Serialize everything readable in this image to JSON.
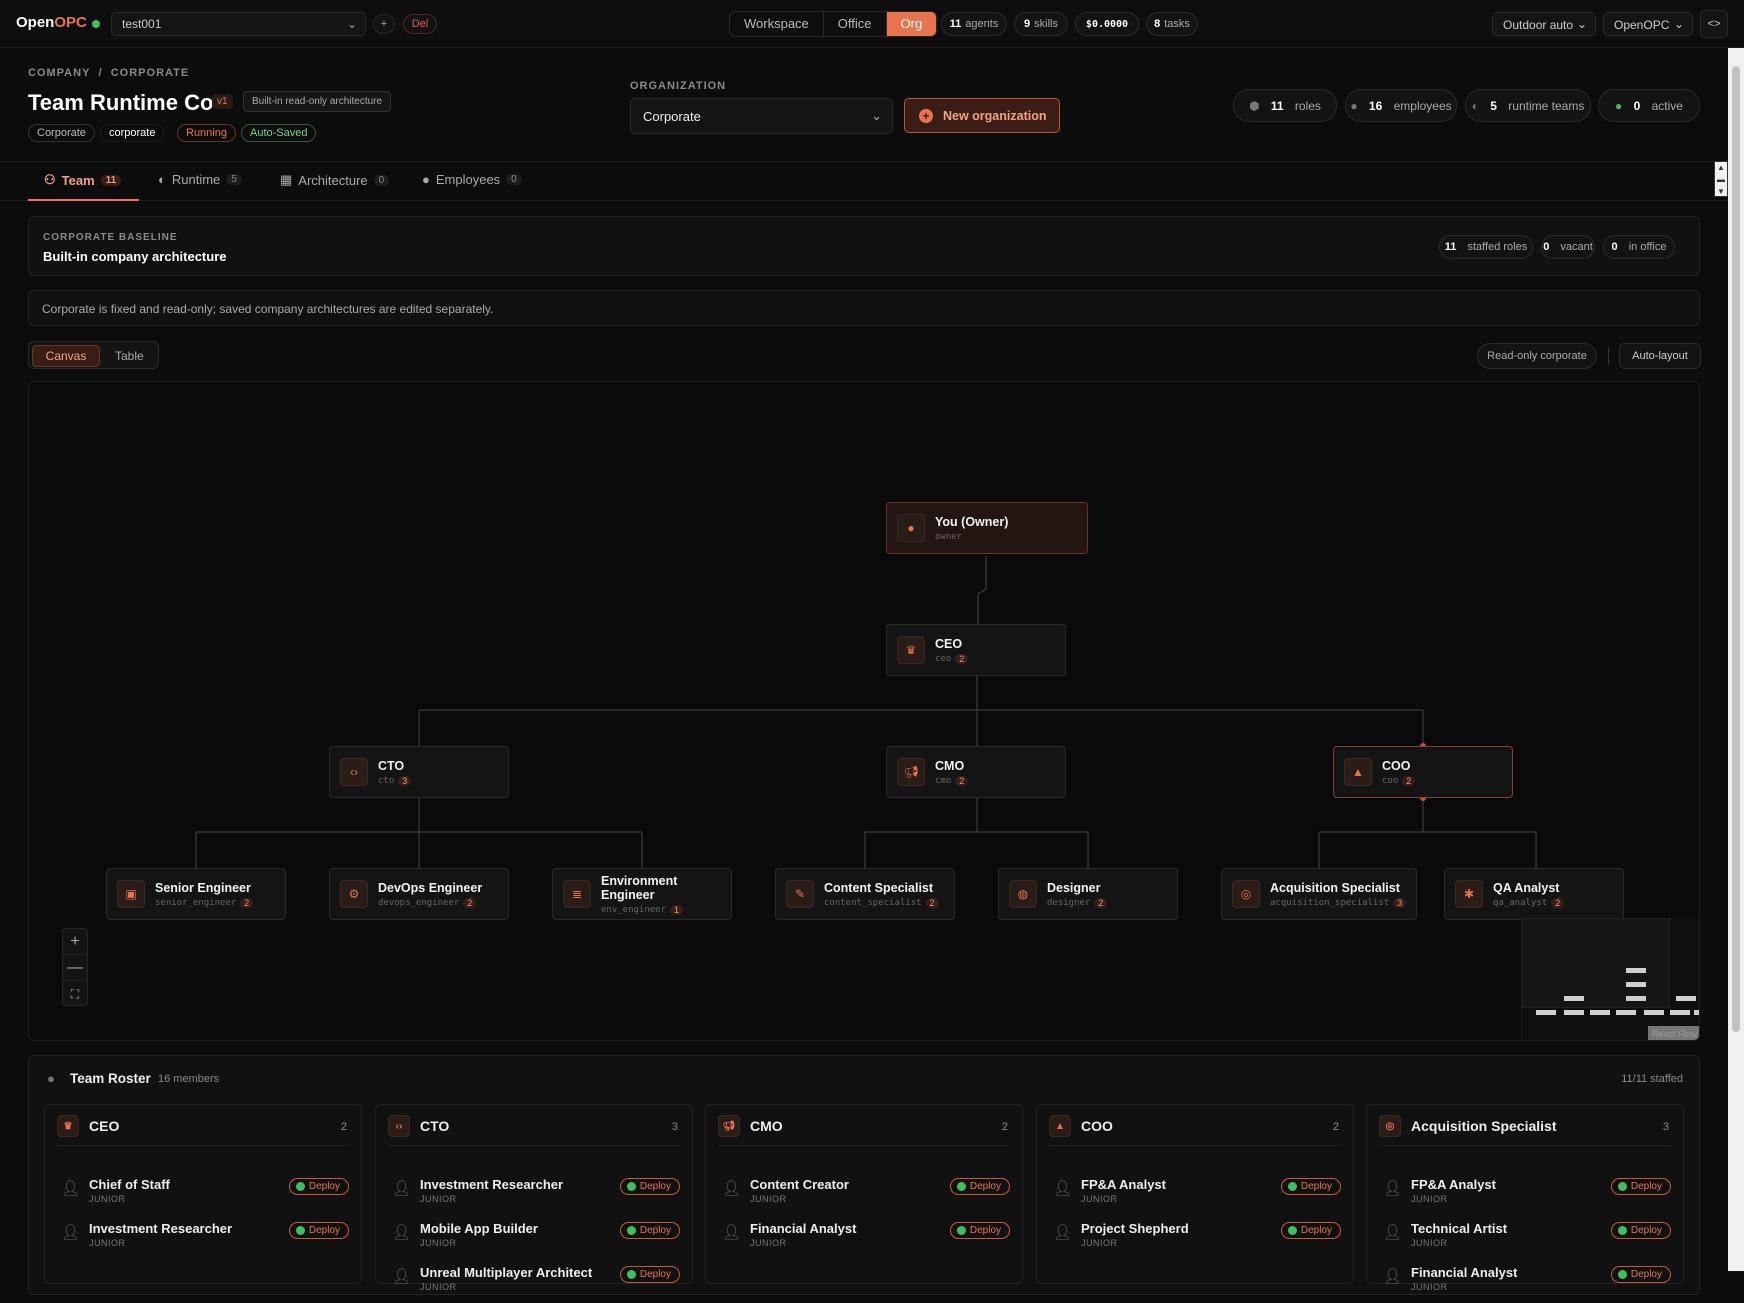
{
  "app": {
    "brand_a": "Open",
    "brand_b": "OPC"
  },
  "top": {
    "workspace_select": "test001",
    "add": "+",
    "del": "Del",
    "modes": [
      "Workspace",
      "Office",
      "Org"
    ],
    "stats": [
      {
        "n": "11",
        "l": "agents"
      },
      {
        "n": "9",
        "l": "skills"
      },
      {
        "n": "$0.0000",
        "l": ""
      },
      {
        "n": "8",
        "l": "tasks"
      }
    ],
    "right_select_1": "Outdoor auto",
    "right_select_2": "OpenOPC",
    "collapse": "<>"
  },
  "header": {
    "crumb_1": "COMPANY",
    "crumb_sep": "/",
    "crumb_2": "CORPORATE",
    "title": "Team Runtime Co",
    "version": "v1",
    "builtin": "Built-in read-only architecture",
    "tags": [
      "Corporate",
      "corporate",
      "Running",
      "Auto-Saved"
    ],
    "org_label": "ORGANIZATION",
    "org_value": "Corporate",
    "new_org": "New organization",
    "counters": [
      {
        "n": "11",
        "l": "roles"
      },
      {
        "n": "16",
        "l": "employees"
      },
      {
        "n": "5",
        "l": "runtime teams"
      },
      {
        "n": "0",
        "l": "active"
      }
    ]
  },
  "tabs": [
    {
      "label": "Team",
      "n": "11"
    },
    {
      "label": "Runtime",
      "n": "5"
    },
    {
      "label": "Architecture",
      "n": "0"
    },
    {
      "label": "Employees",
      "n": "0"
    }
  ],
  "baseline": {
    "kicker": "CORPORATE BASELINE",
    "title": "Built-in company architecture",
    "stats": [
      {
        "n": "11",
        "l": "staffed roles"
      },
      {
        "n": "0",
        "l": "vacant"
      },
      {
        "n": "0",
        "l": "in office"
      }
    ]
  },
  "notice": "Corporate is fixed and read-only; saved company architectures are edited separately.",
  "view": {
    "canvas": "Canvas",
    "table": "Table",
    "readonly": "Read-only corporate",
    "autolayout": "Auto-layout"
  },
  "nodes": {
    "owner": {
      "title": "You (Owner)",
      "sub": "owner"
    },
    "ceo": {
      "title": "CEO",
      "sub": "ceo",
      "n": "2"
    },
    "cto": {
      "title": "CTO",
      "sub": "cto",
      "n": "3"
    },
    "cmo": {
      "title": "CMO",
      "sub": "cmo",
      "n": "2"
    },
    "coo": {
      "title": "COO",
      "sub": "coo",
      "n": "2"
    },
    "se": {
      "title": "Senior Engineer",
      "sub": "senior_engineer",
      "n": "2"
    },
    "devops": {
      "title": "DevOps Engineer",
      "sub": "devops_engineer",
      "n": "2"
    },
    "env": {
      "title": "Environment Engineer",
      "sub": "env_engineer",
      "n": "1"
    },
    "content": {
      "title": "Content Specialist",
      "sub": "content_specialist",
      "n": "2"
    },
    "designer": {
      "title": "Designer",
      "sub": "designer",
      "n": "2"
    },
    "acq": {
      "title": "Acquisition Specialist",
      "sub": "acquisition_specialist",
      "n": "3"
    },
    "qa": {
      "title": "QA Analyst",
      "sub": "qa_analyst",
      "n": "2"
    }
  },
  "zoom": {
    "plus": "+",
    "minus": "—",
    "fit": "⛶"
  },
  "minimap_label": "React Flow",
  "roster": {
    "title": "Team Roster",
    "count": "16 members",
    "staffed": "11/11 staffed",
    "deploy": "Deploy",
    "cols": [
      {
        "name": "CEO",
        "n": "2",
        "members": [
          {
            "name": "Chief of Staff",
            "level": "JUNIOR"
          },
          {
            "name": "Investment Researcher",
            "level": "JUNIOR"
          }
        ]
      },
      {
        "name": "CTO",
        "n": "3",
        "members": [
          {
            "name": "Investment Researcher",
            "level": "JUNIOR"
          },
          {
            "name": "Mobile App Builder",
            "level": "JUNIOR"
          },
          {
            "name": "Unreal Multiplayer Architect",
            "level": "JUNIOR"
          }
        ]
      },
      {
        "name": "CMO",
        "n": "2",
        "members": [
          {
            "name": "Content Creator",
            "level": "JUNIOR"
          },
          {
            "name": "Financial Analyst",
            "level": "JUNIOR"
          }
        ]
      },
      {
        "name": "COO",
        "n": "2",
        "members": [
          {
            "name": "FP&A Analyst",
            "level": "JUNIOR"
          },
          {
            "name": "Project Shepherd",
            "level": "JUNIOR"
          }
        ]
      },
      {
        "name": "Acquisition Specialist",
        "n": "3",
        "members": [
          {
            "name": "FP&A Analyst",
            "level": "JUNIOR"
          },
          {
            "name": "Technical Artist",
            "level": "JUNIOR"
          },
          {
            "name": "Financial Analyst",
            "level": "JUNIOR"
          }
        ]
      }
    ]
  }
}
